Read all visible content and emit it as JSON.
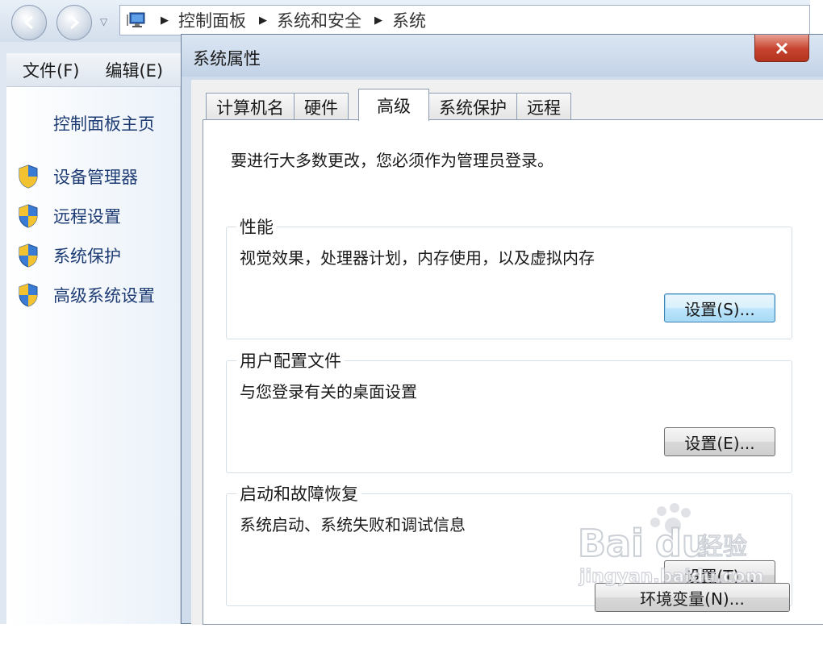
{
  "explorer": {
    "breadcrumb": [
      "控制面板",
      "系统和安全",
      "系统"
    ],
    "menu": [
      "文件(F)",
      "编辑(E)"
    ],
    "sidebar": {
      "home": "控制面板主页",
      "links": [
        "设备管理器",
        "远程设置",
        "系统保护",
        "高级系统设置"
      ]
    }
  },
  "dialog": {
    "title": "系统属性",
    "tabs": [
      "计算机名",
      "硬件",
      "高级",
      "系统保护",
      "远程"
    ],
    "active_tab": "高级",
    "intro": "要进行大多数更改，您必须作为管理员登录。",
    "groups": [
      {
        "title": "性能",
        "desc": "视觉效果，处理器计划，内存使用，以及虚拟内存",
        "button": "设置(S)..."
      },
      {
        "title": "用户配置文件",
        "desc": "与您登录有关的桌面设置",
        "button": "设置(E)..."
      },
      {
        "title": "启动和故障恢复",
        "desc": "系统启动、系统失败和调试信息",
        "button": "设置(T)..."
      }
    ],
    "env_button": "环境变量(N)..."
  },
  "watermark": {
    "brand": "Baidu经验",
    "url": "jingyan.baidu.com"
  },
  "colors": {
    "link": "#1e3c74",
    "close": "#c6432e",
    "focus": "#3c7fb1"
  }
}
